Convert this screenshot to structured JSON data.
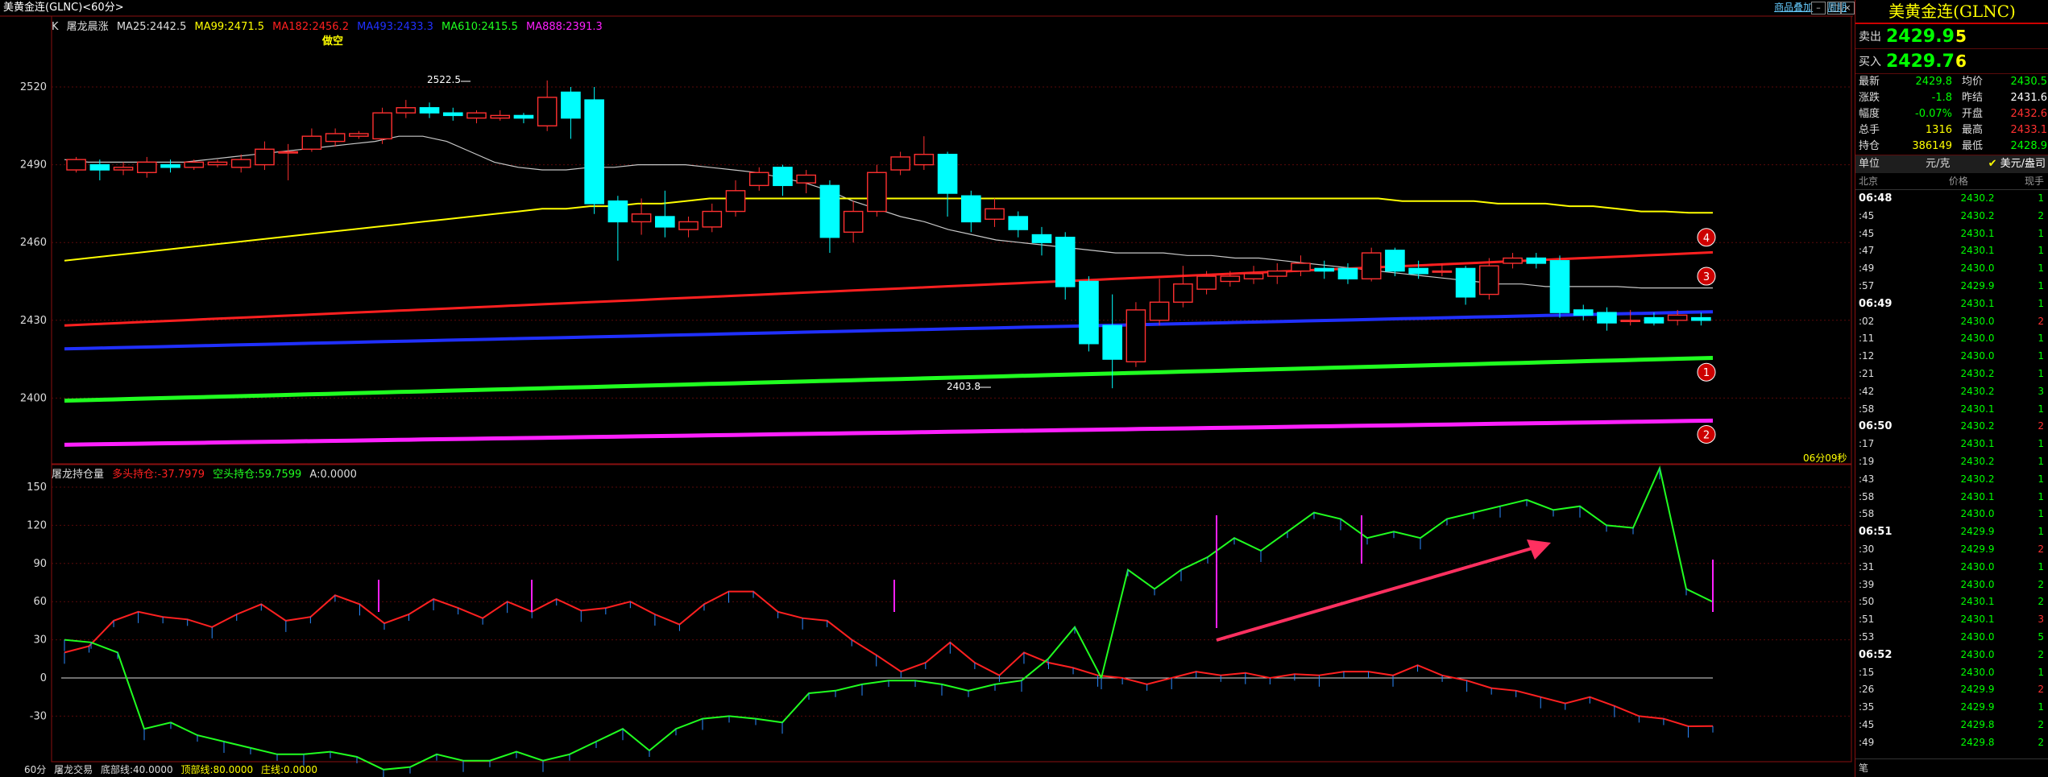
{
  "window": {
    "title": "美黄金连(GLNC)<60分>"
  },
  "top_links": [
    "商品叠加",
    "周期"
  ],
  "indicator": {
    "k_label": "K",
    "name": "屠龙晨涨",
    "ma25": "MA25:2442.5",
    "ma99": "MA99:2471.5",
    "ma182": "MA182:2456.2",
    "ma493": "MA493:2433.3",
    "ma610": "MA610:2415.5",
    "ma888": "MA888:2391.3",
    "signal": "做空",
    "high_label": "2522.5",
    "low_label": "2403.8",
    "countdown": "06分09秒"
  },
  "lower": {
    "name": "屠龙持仓量",
    "long": "多头持仓:-37.7979",
    "short": "空头持仓:59.7599",
    "a": "A:0.0000"
  },
  "bottom_bar": {
    "period": "60分",
    "name": "屠龙交易",
    "bottom_line": "底部线:40.0000",
    "top_line": "顶部线:80.0000",
    "zhuang": "庄线:0.0000"
  },
  "upper_axis": [
    "2520",
    "2490",
    "2460",
    "2430",
    "2400"
  ],
  "lower_axis": [
    "150",
    "120",
    "90",
    "60",
    "30",
    "0",
    "-30"
  ],
  "markers": [
    "4",
    "3",
    "1",
    "2"
  ],
  "colors": {
    "ma25": "#c8c8c8",
    "ma99": "#ffff00",
    "ma182": "#ff2020",
    "ma493": "#2030ff",
    "ma610": "#20ff20",
    "ma888": "#ff20ff",
    "bull": "#ff3030",
    "bear": "#00ffff"
  },
  "panel": {
    "title": "美黄金连(GLNC)",
    "sell_label": "卖出",
    "sell_price": "2429.9",
    "sell_vol": "5",
    "buy_label": "买入",
    "buy_price": "2429.7",
    "buy_vol": "6",
    "stats": [
      {
        "l1": "最新",
        "v1": "2429.8",
        "c1": "#00ff00",
        "l2": "均价",
        "v2": "2430.5",
        "c2": "#00ff00"
      },
      {
        "l1": "涨跌",
        "v1": "-1.8",
        "c1": "#00ff00",
        "l2": "昨结",
        "v2": "2431.6",
        "c2": "#ffffff"
      },
      {
        "l1": "幅度",
        "v1": "-0.07%",
        "c1": "#00ff00",
        "l2": "开盘",
        "v2": "2432.6",
        "c2": "#ff3030"
      },
      {
        "l1": "总手",
        "v1": "1316",
        "c1": "#ffff00",
        "l2": "最高",
        "v2": "2433.1",
        "c2": "#ff3030"
      },
      {
        "l1": "持仓",
        "v1": "386149",
        "c1": "#ffff00",
        "l2": "最低",
        "v2": "2428.9",
        "c2": "#00ff00"
      }
    ],
    "unit_label": "单位",
    "unit_value": "元/克",
    "unit_alt": "美元/盎司",
    "tick_headers": [
      "北京",
      "价格",
      "现手"
    ],
    "ticks": [
      {
        "t": "06:48",
        "p": "2430.2",
        "v": "1",
        "pc": "#00ff00",
        "vc": "#00ff00",
        "b": true
      },
      {
        "t": ":45",
        "p": "2430.2",
        "v": "2",
        "pc": "#00ff00",
        "vc": "#00ff00",
        "b": false
      },
      {
        "t": ":45",
        "p": "2430.1",
        "v": "1",
        "pc": "#00ff00",
        "vc": "#00ff00",
        "b": false
      },
      {
        "t": ":47",
        "p": "2430.1",
        "v": "1",
        "pc": "#00ff00",
        "vc": "#00ff00",
        "b": false
      },
      {
        "t": ":49",
        "p": "2430.0",
        "v": "1",
        "pc": "#00ff00",
        "vc": "#00ff00",
        "b": false
      },
      {
        "t": ":57",
        "p": "2429.9",
        "v": "1",
        "pc": "#00ff00",
        "vc": "#00ff00",
        "b": false
      },
      {
        "t": "06:49",
        "p": "2430.1",
        "v": "1",
        "pc": "#00ff00",
        "vc": "#00ff00",
        "b": true
      },
      {
        "t": ":02",
        "p": "2430.0",
        "v": "2",
        "pc": "#00ff00",
        "vc": "#ff3030",
        "b": false
      },
      {
        "t": ":11",
        "p": "2430.0",
        "v": "1",
        "pc": "#00ff00",
        "vc": "#00ff00",
        "b": false
      },
      {
        "t": ":12",
        "p": "2430.0",
        "v": "1",
        "pc": "#00ff00",
        "vc": "#00ff00",
        "b": false
      },
      {
        "t": ":21",
        "p": "2430.2",
        "v": "1",
        "pc": "#00ff00",
        "vc": "#00ff00",
        "b": false
      },
      {
        "t": ":42",
        "p": "2430.2",
        "v": "3",
        "pc": "#00ff00",
        "vc": "#00ff00",
        "b": false
      },
      {
        "t": ":58",
        "p": "2430.1",
        "v": "1",
        "pc": "#00ff00",
        "vc": "#00ff00",
        "b": false
      },
      {
        "t": "06:50",
        "p": "2430.2",
        "v": "2",
        "pc": "#00ff00",
        "vc": "#ff3030",
        "b": true
      },
      {
        "t": ":17",
        "p": "2430.1",
        "v": "1",
        "pc": "#00ff00",
        "vc": "#00ff00",
        "b": false
      },
      {
        "t": ":19",
        "p": "2430.2",
        "v": "1",
        "pc": "#00ff00",
        "vc": "#00ff00",
        "b": false
      },
      {
        "t": ":43",
        "p": "2430.2",
        "v": "1",
        "pc": "#00ff00",
        "vc": "#00ff00",
        "b": false
      },
      {
        "t": ":58",
        "p": "2430.1",
        "v": "1",
        "pc": "#00ff00",
        "vc": "#00ff00",
        "b": false
      },
      {
        "t": ":58",
        "p": "2430.0",
        "v": "1",
        "pc": "#00ff00",
        "vc": "#00ff00",
        "b": false
      },
      {
        "t": "06:51",
        "p": "2429.9",
        "v": "1",
        "pc": "#00ff00",
        "vc": "#00ff00",
        "b": true
      },
      {
        "t": ":30",
        "p": "2429.9",
        "v": "2",
        "pc": "#00ff00",
        "vc": "#ff3030",
        "b": false
      },
      {
        "t": ":31",
        "p": "2430.0",
        "v": "1",
        "pc": "#00ff00",
        "vc": "#00ff00",
        "b": false
      },
      {
        "t": ":39",
        "p": "2430.0",
        "v": "2",
        "pc": "#00ff00",
        "vc": "#00ff00",
        "b": false
      },
      {
        "t": ":50",
        "p": "2430.1",
        "v": "2",
        "pc": "#00ff00",
        "vc": "#00ff00",
        "b": false
      },
      {
        "t": ":51",
        "p": "2430.1",
        "v": "3",
        "pc": "#00ff00",
        "vc": "#ff3030",
        "b": false
      },
      {
        "t": ":53",
        "p": "2430.0",
        "v": "5",
        "pc": "#00ff00",
        "vc": "#00ff00",
        "b": false
      },
      {
        "t": "06:52",
        "p": "2430.0",
        "v": "2",
        "pc": "#00ff00",
        "vc": "#00ff00",
        "b": true
      },
      {
        "t": ":15",
        "p": "2430.0",
        "v": "1",
        "pc": "#00ff00",
        "vc": "#00ff00",
        "b": false
      },
      {
        "t": ":26",
        "p": "2429.9",
        "v": "2",
        "pc": "#00ff00",
        "vc": "#ff3030",
        "b": false
      },
      {
        "t": ":35",
        "p": "2429.9",
        "v": "1",
        "pc": "#00ff00",
        "vc": "#00ff00",
        "b": false
      },
      {
        "t": ":45",
        "p": "2429.8",
        "v": "2",
        "pc": "#00ff00",
        "vc": "#00ff00",
        "b": false
      },
      {
        "t": ":49",
        "p": "2429.8",
        "v": "2",
        "pc": "#00ff00",
        "vc": "#00ff00",
        "b": false
      }
    ],
    "footer": "笔"
  }
}
